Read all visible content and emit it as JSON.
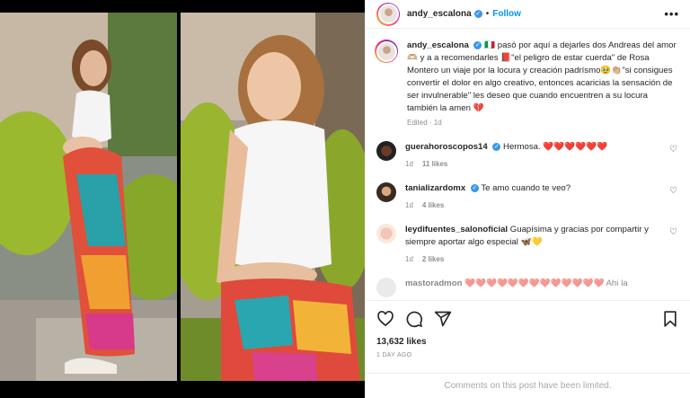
{
  "post": {
    "username": "andy_escalona",
    "follow_label": "Follow",
    "more_label": "•••",
    "caption_user": "andy_escalona",
    "caption_text": "🇮🇹 pasó por aquí a dejarles dos Andreas del amor 🫶🏼 y a a recomendarles 📕\"el peligro de estar cuerda\" de Rosa Montero un viaje por la locura y creación padrísmo🥹👏🏼\"si consigues convertir el dolor en algo creativo, entonces acaricias la sensación de ser invulnerable\" les deseo que cuando encuentren a su locura también la amen 💔",
    "caption_meta": "Edited · 1d",
    "likes": "13,632 likes",
    "date": "1 DAY AGO",
    "limited_text": "Comments on this post have been limited."
  },
  "comments": [
    {
      "user": "guerahoroscopos14",
      "text": "Hermosa. ❤️❤️❤️❤️❤️❤️",
      "age": "1d",
      "likes": "11 likes",
      "verified": true
    },
    {
      "user": "tanializardomx",
      "text": "Te amo cuando te veo?",
      "age": "1d",
      "likes": "4 likes",
      "verified": true
    },
    {
      "user": "leydifuentes_salonoficial",
      "text": "Guapísima y gracias por compartir y siempre aportar algo especial 🦋💛",
      "age": "1d",
      "likes": "2 likes",
      "verified": false
    },
    {
      "user": "mastoradmon",
      "text": "❤️❤️❤️❤️❤️❤️❤️❤️❤️❤️❤️❤️❤️ Ahi la",
      "age": "",
      "likes": "",
      "verified": false
    }
  ],
  "colors": {
    "accent": "#0095f6",
    "verified": "#3897f0",
    "muted": "#8e8e8e"
  }
}
